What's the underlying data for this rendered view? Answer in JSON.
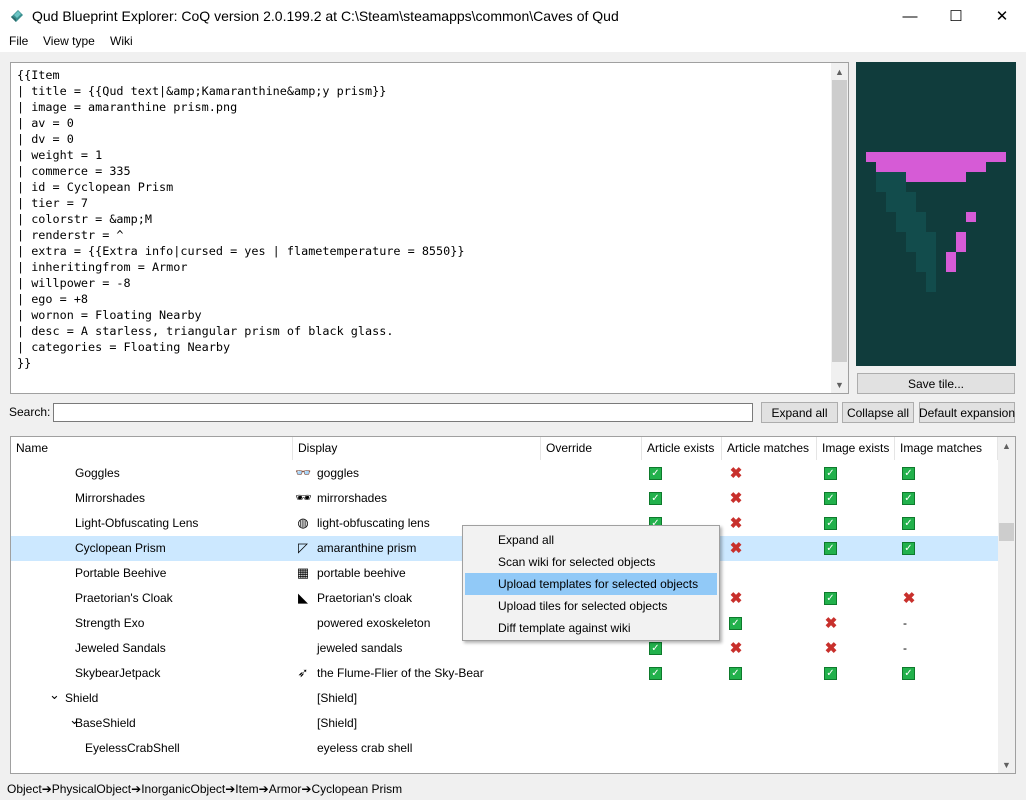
{
  "window": {
    "title": "Qud Blueprint Explorer: CoQ version 2.0.199.2 at C:\\Steam\\steamapps\\common\\Caves of Qud",
    "minimize_glyph": "—",
    "maximize_glyph": "☐",
    "close_glyph": "✕"
  },
  "menu": [
    "File",
    "View type",
    "Wiki"
  ],
  "editor": {
    "text": "{{Item\n| title = {{Qud text|&amp;Kamaranthine&amp;y prism}}\n| image = amaranthine prism.png\n| av = 0\n| dv = 0\n| weight = 1\n| commerce = 335\n| id = Cyclopean Prism\n| tier = 7\n| colorstr = &amp;M\n| renderstr = ^\n| extra = {{Extra info|cursed = yes | flametemperature = 8550}}\n| inheritingfrom = Armor\n| willpower = -8\n| ego = +8\n| wornon = Floating Nearby\n| desc = A starless, triangular prism of black glass.\n| categories = Floating Nearby\n}}"
  },
  "tile": {
    "background": "#103c3c",
    "prism_color": "#d65bd6",
    "shadow_color": "#124c4c",
    "save_label": "Save tile..."
  },
  "search": {
    "label": "Search:",
    "value": "",
    "expand_all": "Expand all",
    "collapse_all": "Collapse all",
    "default_expansion": "Default expansion"
  },
  "tree": {
    "columns": [
      "Name",
      "Display",
      "Override",
      "Article exists",
      "Article matches",
      "Image exists",
      "Image matches"
    ],
    "rows": [
      {
        "name": "Goggles",
        "indent": 3,
        "icon": "goggles-icon",
        "glyph": "👓",
        "display": "goggles",
        "override": "",
        "article_exists": "yes",
        "article_matches": "no",
        "image_exists": "yes",
        "image_matches": "yes"
      },
      {
        "name": "Mirrorshades",
        "indent": 3,
        "icon": "mirrorshades-icon",
        "glyph": "🕶",
        "display": "mirrorshades",
        "override": "",
        "article_exists": "yes",
        "article_matches": "no",
        "image_exists": "yes",
        "image_matches": "yes"
      },
      {
        "name": "Light-Obfuscating Lens",
        "indent": 3,
        "icon": "lens-icon",
        "glyph": "◍",
        "display": "light-obfuscating lens",
        "override": "",
        "article_exists": "yes",
        "article_matches": "no",
        "image_exists": "yes",
        "image_matches": "yes"
      },
      {
        "name": "Cyclopean Prism",
        "indent": 3,
        "icon": "prism-icon",
        "glyph": "◸",
        "display": "amaranthine prism",
        "override": "",
        "article_exists": "yes",
        "article_matches": "no",
        "image_exists": "yes",
        "image_matches": "yes",
        "selected": true
      },
      {
        "name": "Portable Beehive",
        "indent": 3,
        "icon": "beehive-icon",
        "glyph": "▦",
        "display": "portable beehive",
        "override": "",
        "article_exists": "",
        "article_matches": "",
        "image_exists": "",
        "image_matches": ""
      },
      {
        "name": "Praetorian's Cloak",
        "indent": 3,
        "icon": "cloak-icon",
        "glyph": "◣",
        "display": "Praetorian's cloak",
        "override": "",
        "article_exists": "",
        "article_matches": "no",
        "image_exists": "yes",
        "image_matches": "no"
      },
      {
        "name": "Strength Exo",
        "indent": 3,
        "icon": "",
        "glyph": "",
        "display": "powered exoskeleton",
        "override": "",
        "article_exists": "",
        "article_matches": "yes",
        "image_exists": "no",
        "image_matches": "-"
      },
      {
        "name": "Jeweled Sandals",
        "indent": 3,
        "icon": "",
        "glyph": "",
        "display": "jeweled sandals",
        "override": "",
        "article_exists": "yes",
        "article_matches": "no",
        "image_exists": "no",
        "image_matches": "-"
      },
      {
        "name": "SkybearJetpack",
        "indent": 3,
        "icon": "jetpack-icon",
        "glyph": "➶",
        "display": "the Flume-Flier of the Sky-Bear",
        "override": "",
        "article_exists": "yes",
        "article_matches": "yes",
        "image_exists": "yes",
        "image_matches": "yes"
      },
      {
        "name": "Shield",
        "indent": 1,
        "expander": "⌄",
        "icon": "",
        "glyph": "",
        "display": "[Shield]",
        "override": "",
        "article_exists": "",
        "article_matches": "",
        "image_exists": "",
        "image_matches": ""
      },
      {
        "name": "BaseShield",
        "indent": 2,
        "expander": "⌄",
        "icon": "",
        "glyph": "",
        "display": "[Shield]",
        "override": "",
        "article_exists": "",
        "article_matches": "",
        "image_exists": "",
        "image_matches": ""
      },
      {
        "name": "EyelessCrabShell",
        "indent": 4,
        "icon": "",
        "glyph": "",
        "display": "eyeless crab shell",
        "override": "",
        "article_exists": "",
        "article_matches": "",
        "image_exists": "",
        "image_matches": ""
      }
    ]
  },
  "context_menu": {
    "items": [
      {
        "label": "Expand all",
        "highlighted": false
      },
      {
        "label": "Scan wiki for selected objects",
        "highlighted": false
      },
      {
        "label": "Upload templates for selected objects",
        "highlighted": true
      },
      {
        "label": "Upload tiles for selected objects",
        "highlighted": false
      },
      {
        "label": "Diff template against wiki",
        "highlighted": false
      }
    ]
  },
  "status": {
    "path": [
      "Object",
      "PhysicalObject",
      "InorganicObject",
      "Item",
      "Armor",
      "Cyclopean Prism"
    ],
    "separator": "➔"
  },
  "colors": {
    "selected_row": "#cce8ff",
    "check_green": "#22b14c",
    "cross_red": "#c8302c",
    "menu_highlight": "#91c9f7"
  }
}
